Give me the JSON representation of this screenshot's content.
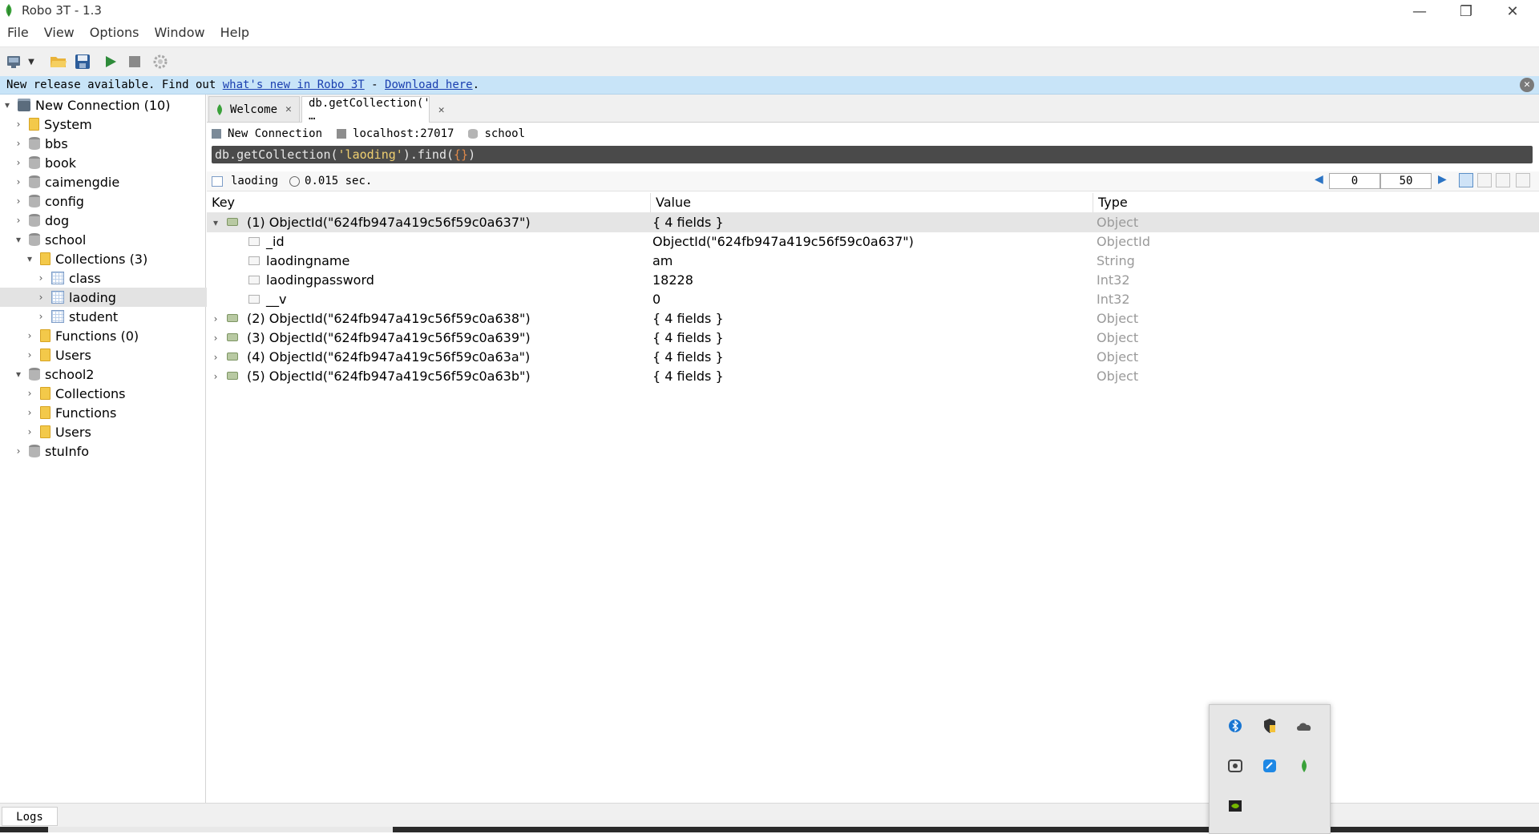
{
  "window": {
    "title": "Robo 3T - 1.3"
  },
  "menu": [
    "File",
    "View",
    "Options",
    "Window",
    "Help"
  ],
  "notice": {
    "text": "New release available. Find out ",
    "link1": "what's new in Robo 3T",
    "sep": " - ",
    "link2": "Download here",
    "end": "."
  },
  "sidebar": {
    "connection": "New Connection (10)",
    "items": [
      {
        "label": "System",
        "icon": "folder-icon"
      },
      {
        "label": "bbs",
        "icon": "database-icon"
      },
      {
        "label": "book",
        "icon": "database-icon"
      },
      {
        "label": "caimengdie",
        "icon": "database-icon"
      },
      {
        "label": "config",
        "icon": "database-icon"
      },
      {
        "label": "dog",
        "icon": "database-icon"
      },
      {
        "label": "school",
        "icon": "database-icon"
      },
      {
        "label": "Collections (3)",
        "icon": "folder-icon"
      },
      {
        "label": "class",
        "icon": "collection-icon"
      },
      {
        "label": "laoding",
        "icon": "collection-icon"
      },
      {
        "label": "student",
        "icon": "collection-icon"
      },
      {
        "label": "Functions (0)",
        "icon": "folder-icon"
      },
      {
        "label": "Users",
        "icon": "folder-icon"
      },
      {
        "label": "school2",
        "icon": "database-icon"
      },
      {
        "label": "Collections",
        "icon": "folder-icon"
      },
      {
        "label": "Functions",
        "icon": "folder-icon"
      },
      {
        "label": "Users",
        "icon": "folder-icon"
      },
      {
        "label": "stuInfo",
        "icon": "database-icon"
      }
    ]
  },
  "tabs": [
    {
      "label": "Welcome"
    },
    {
      "label": "db.getCollection(' …"
    }
  ],
  "context": {
    "connection": "New Connection",
    "host": "localhost:27017",
    "db": "school"
  },
  "query": {
    "prefix": "db.getCollection(",
    "arg": "'laoding'",
    "mid": ").find(",
    "braces": "{}",
    "suffix": ")"
  },
  "result": {
    "collection": "laoding",
    "time": "0.015 sec.",
    "skip": "0",
    "limit": "50"
  },
  "table": {
    "headers": [
      "Key",
      "Value",
      "Type"
    ],
    "rows": [
      {
        "key": "(1) ObjectId(\"624fb947a419c56f59c0a637\")",
        "value": "{ 4 fields }",
        "type": "Object"
      },
      {
        "key": "_id",
        "value": "ObjectId(\"624fb947a419c56f59c0a637\")",
        "type": "ObjectId"
      },
      {
        "key": "laodingname",
        "value": "am",
        "type": "String"
      },
      {
        "key": "laodingpassword",
        "value": "18228",
        "type": "Int32"
      },
      {
        "key": "__v",
        "value": "0",
        "type": "Int32"
      },
      {
        "key": "(2) ObjectId(\"624fb947a419c56f59c0a638\")",
        "value": "{ 4 fields }",
        "type": "Object"
      },
      {
        "key": "(3) ObjectId(\"624fb947a419c56f59c0a639\")",
        "value": "{ 4 fields }",
        "type": "Object"
      },
      {
        "key": "(4) ObjectId(\"624fb947a419c56f59c0a63a\")",
        "value": "{ 4 fields }",
        "type": "Object"
      },
      {
        "key": "(5) ObjectId(\"624fb947a419c56f59c0a63b\")",
        "value": "{ 4 fields }",
        "type": "Object"
      }
    ]
  },
  "logs": {
    "label": "Logs"
  },
  "colors": {
    "notice_bg": "#c8e4f8",
    "link": "#1a3fb0",
    "query_bg": "#4a4a4a",
    "selection": "#e5e5e5"
  }
}
